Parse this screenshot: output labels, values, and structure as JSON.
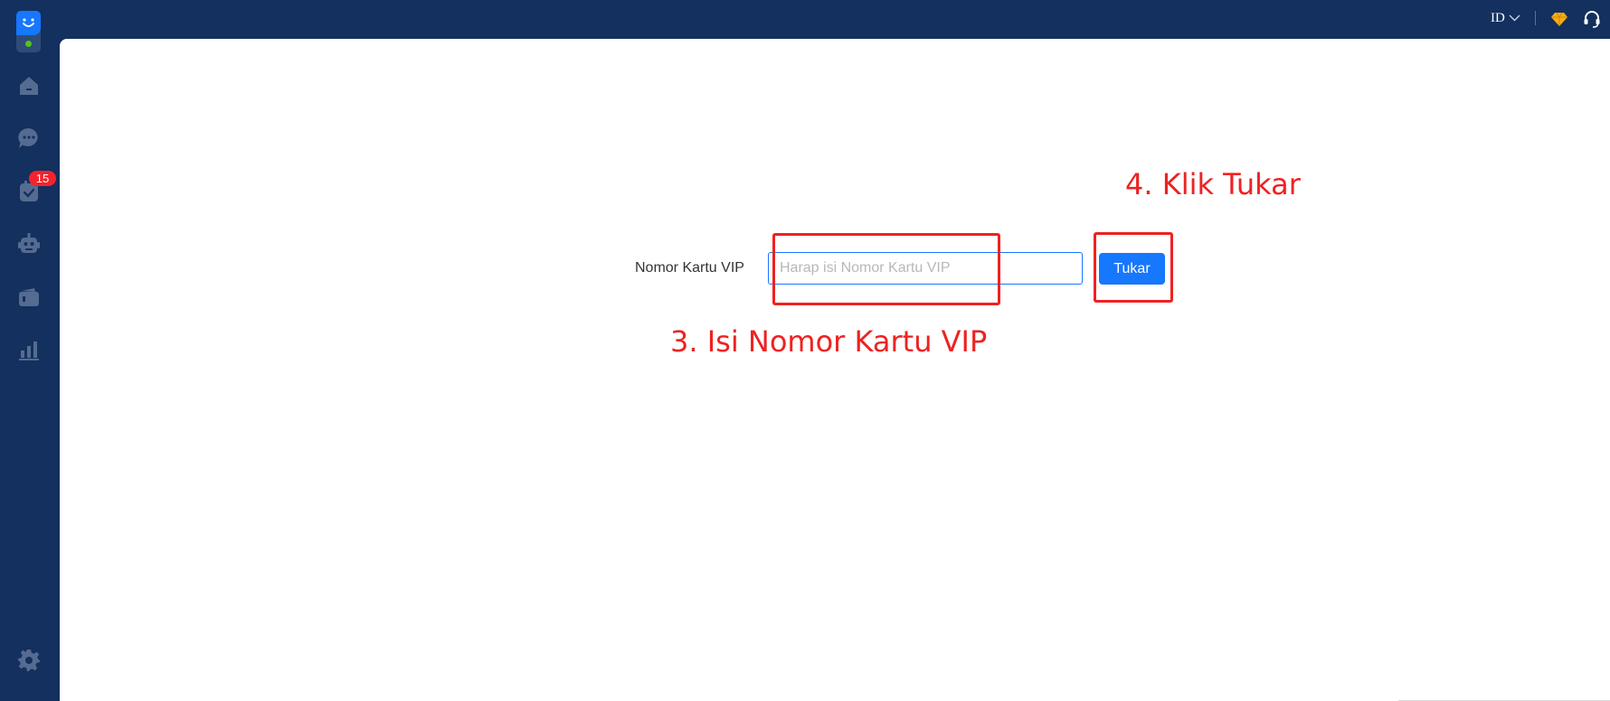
{
  "sidebar": {
    "nav": [
      {
        "icon": "home-icon"
      },
      {
        "icon": "chat-icon"
      },
      {
        "icon": "task-icon",
        "badge": "15"
      },
      {
        "icon": "robot-icon"
      },
      {
        "icon": "wallet-icon"
      },
      {
        "icon": "stats-icon"
      }
    ],
    "settings_icon": "gear-icon"
  },
  "topbar": {
    "language": "ID",
    "icons": [
      "vip-diamond-icon",
      "headset-icon"
    ]
  },
  "form": {
    "label": "Nomor Kartu VIP",
    "input_value": "",
    "input_placeholder": "Harap isi Nomor Kartu VIP",
    "button_label": "Tukar"
  },
  "annotations": {
    "step3": "3. Isi Nomor Kartu VIP",
    "step4": "4. Klik Tukar",
    "color": "#ee2222"
  },
  "colors": {
    "sidebar_bg": "#13305e",
    "accent": "#1677ff",
    "badge": "#f5222d",
    "diamond": "#faad14"
  }
}
